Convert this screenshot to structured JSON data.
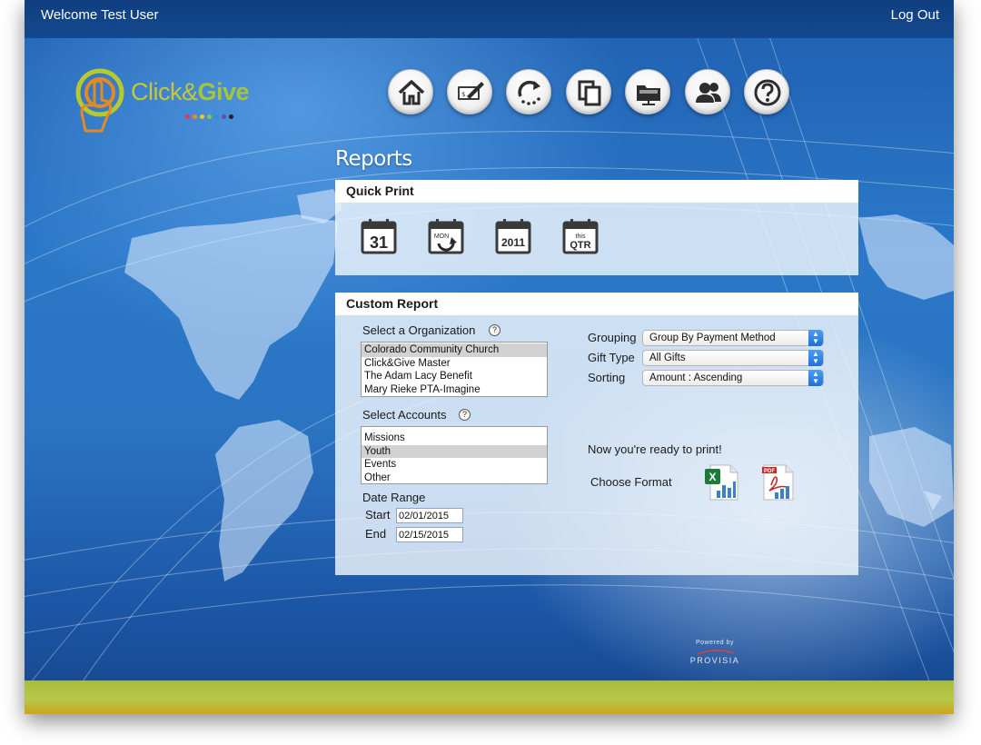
{
  "header": {
    "welcome": "Welcome Test User",
    "logout": "Log Out"
  },
  "logo": {
    "click": "Click&",
    "give": "Give"
  },
  "nav": [
    {
      "icon": "home-icon"
    },
    {
      "icon": "check-write-icon"
    },
    {
      "icon": "recurring-icon"
    },
    {
      "icon": "copy-icon"
    },
    {
      "icon": "folder-icon"
    },
    {
      "icon": "users-icon"
    },
    {
      "icon": "help-icon"
    }
  ],
  "page": {
    "title": "Reports"
  },
  "quick_print": {
    "title": "Quick Print",
    "icons": [
      {
        "icon": "calendar-day-icon",
        "label": "31"
      },
      {
        "icon": "calendar-week-icon",
        "label": "MON"
      },
      {
        "icon": "calendar-year-icon",
        "label": "2011"
      },
      {
        "icon": "calendar-quarter-icon",
        "label_top": "this",
        "label_bottom": "QTR"
      }
    ]
  },
  "custom_report": {
    "title": "Custom Report",
    "organization": {
      "label": "Select a Organization",
      "help": "?",
      "options": [
        "Colorado Community Church",
        "Click&Give Master",
        "The Adam Lacy Benefit",
        "Mary Rieke PTA-Imagine"
      ],
      "selected": "Colorado Community Church"
    },
    "accounts": {
      "label": "Select Accounts",
      "help": "?",
      "options": [
        "Missions",
        "Youth",
        "Events",
        "Other"
      ],
      "selected": "Youth"
    },
    "date_range": {
      "label": "Date Range",
      "start_label": "Start",
      "start_value": "02/01/2015",
      "end_label": "End",
      "end_value": "02/15/2015"
    },
    "grouping": {
      "label": "Grouping",
      "value": "Group By Payment Method"
    },
    "gift_type": {
      "label": "Gift Type",
      "value": "All Gifts"
    },
    "sorting": {
      "label": "Sorting",
      "value": "Amount : Ascending"
    },
    "ready_text": "Now you're ready to print!",
    "format_label": "Choose Format",
    "formats": [
      {
        "icon": "excel-icon"
      },
      {
        "icon": "pdf-icon",
        "label": "PDF"
      }
    ]
  },
  "footer": {
    "powered_by": "Powered by",
    "brand": "PROVISIA"
  },
  "colors": {
    "header": "#14498f",
    "logo_green": "#a7c53a",
    "select_arrow": "#1f6fd8",
    "footer_band": "#b7c84a"
  }
}
